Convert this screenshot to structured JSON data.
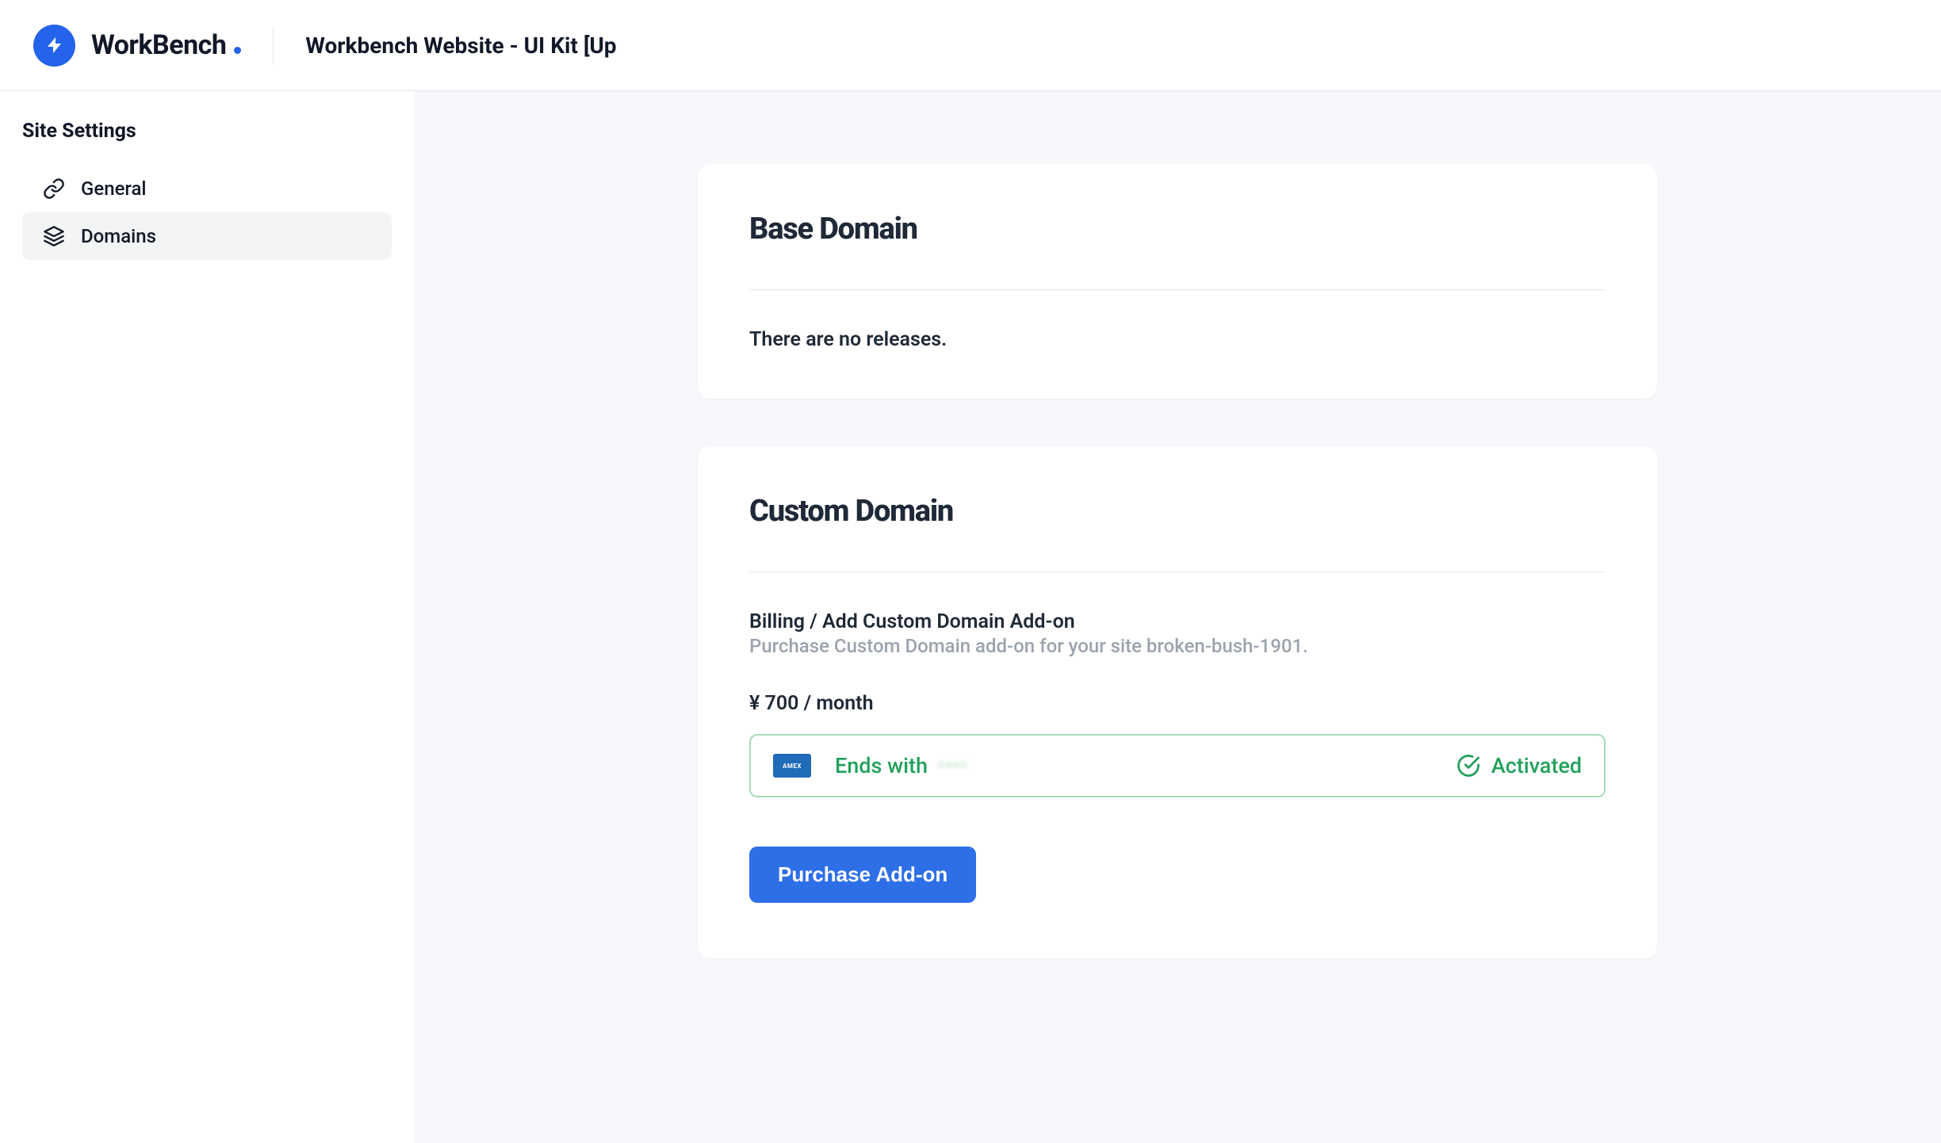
{
  "header": {
    "brand": "WorkBench",
    "page_title": "Workbench Website - UI Kit [Up"
  },
  "sidebar": {
    "heading": "Site Settings",
    "items": [
      {
        "label": "General",
        "icon": "link-icon",
        "active": false
      },
      {
        "label": "Domains",
        "icon": "layers-icon",
        "active": true
      }
    ]
  },
  "base_domain": {
    "title": "Base Domain",
    "body": "There are no releases."
  },
  "custom_domain": {
    "title": "Custom Domain",
    "billing_title": "Billing / Add Custom Domain Add-on",
    "billing_subtitle": "Purchase Custom Domain add-on for your site broken-bush-1901.",
    "price": "¥ 700 / month",
    "payment": {
      "ends_with_label": "Ends with",
      "masked": "••••",
      "status": "Activated",
      "card_brand": "AMEX"
    },
    "purchase_button": "Purchase Add-on"
  }
}
